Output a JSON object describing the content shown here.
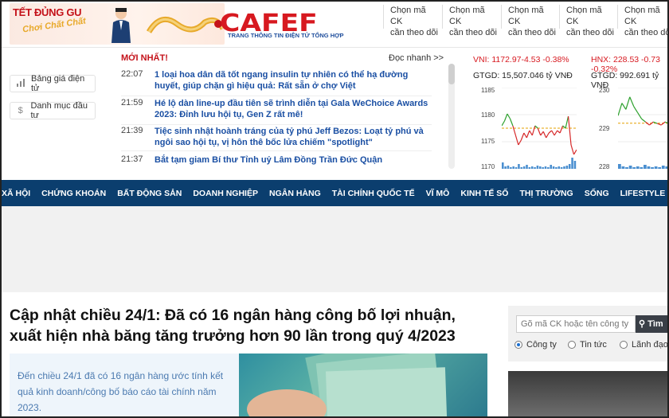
{
  "banner": {
    "tet": "TẾT ĐỦNG GU",
    "tet_sub": "Chơi Chất Chất"
  },
  "logo": {
    "text": "CAFEF",
    "tagline": "TRANG THÔNG TIN ĐIỆN TỬ TỔNG HỢP"
  },
  "stock_pickers": [
    {
      "line1": "Chọn mã CK",
      "line2": "cần theo dõi"
    },
    {
      "line1": "Chọn mã CK",
      "line2": "cần theo dõi"
    },
    {
      "line1": "Chọn mã CK",
      "line2": "cần theo dõi"
    },
    {
      "line1": "Chọn mã CK",
      "line2": "cần theo dõi"
    },
    {
      "line1": "Chọn mã CK",
      "line2": "cần theo dõi"
    }
  ],
  "tools": [
    {
      "label": "Bảng giá điện tử",
      "icon": "bar-chart-icon"
    },
    {
      "label": "Danh mục đầu tư",
      "icon": "dollar-icon"
    }
  ],
  "news": {
    "section_title": "MỚI NHẤT!",
    "quick_read": "Đọc nhanh >>",
    "items": [
      {
        "time": "22:07",
        "title": "1 loại hoa dân dã tốt ngang insulin tự nhiên có thể hạ đường huyết, giúp chặn gì hiệu quả: Rất sẵn ở chợ Việt"
      },
      {
        "time": "21:59",
        "title": "Hé lộ dàn line-up đầu tiên sẽ trình diễn tại Gala WeChoice Awards 2023: Đỉnh lưu hội tụ, Gen Z rất mê!"
      },
      {
        "time": "21:39",
        "title": "Tiệc sinh nhật hoành tráng của tỷ phú Jeff Bezos: Loạt tỷ phú và ngôi sao hội tụ, vị hôn thê bốc lửa chiếm \"spotlight\""
      },
      {
        "time": "21:37",
        "title": "Bắt tạm giam Bí thư Tỉnh uỷ Lâm Đồng Trần Đức Quận"
      }
    ]
  },
  "indices": [
    {
      "name": "VNI: 1172.97-4.53 -0.38%",
      "volume": "GTGD: 15,507.046 tỷ VNĐ",
      "ticks": [
        "1185",
        "1180",
        "1175",
        "1170"
      ],
      "ylim": [
        1169,
        1186
      ],
      "ref": 1177.5
    },
    {
      "name": "HNX: 228.53 -0.73 -0.32%",
      "volume": "GTGD: 992.691 tỷ VNĐ",
      "ticks": [
        "230",
        "229",
        "228"
      ],
      "ylim": [
        227.8,
        230.4
      ],
      "ref": 229.26
    }
  ],
  "nav": [
    "XÃ HỘI",
    "CHỨNG KHOÁN",
    "BẤT ĐỘNG SẢN",
    "DOANH NGHIỆP",
    "NGÂN HÀNG",
    "TÀI CHÍNH QUỐC TẾ",
    "VĨ MÔ",
    "KINH TẾ SỐ",
    "THỊ TRƯỜNG",
    "SỐNG",
    "LIFESTYLE",
    "•••"
  ],
  "article": {
    "headline": "Cập nhật chiều 24/1: Đã có 16 ngân hàng công bố lợi nhuận, xuất hiện nhà băng tăng trưởng hơn 90 lần trong quý 4/2023",
    "sapo": "Đến chiều 24/1 đã có 16 ngân hàng ước tính kết quả kinh doanh/công bố báo cáo tài chính năm 2023."
  },
  "sidebar_search": {
    "placeholder": "Gõ mã CK hoặc tên công ty",
    "button": "Tìm",
    "options": [
      {
        "label": "Công ty",
        "selected": true
      },
      {
        "label": "Tin tức",
        "selected": false
      },
      {
        "label": "Lãnh đạo",
        "selected": false
      }
    ]
  },
  "colors": {
    "brand_red": "#d71920",
    "nav_blue": "#0b3e6e",
    "link_blue": "#1a4fa3"
  }
}
